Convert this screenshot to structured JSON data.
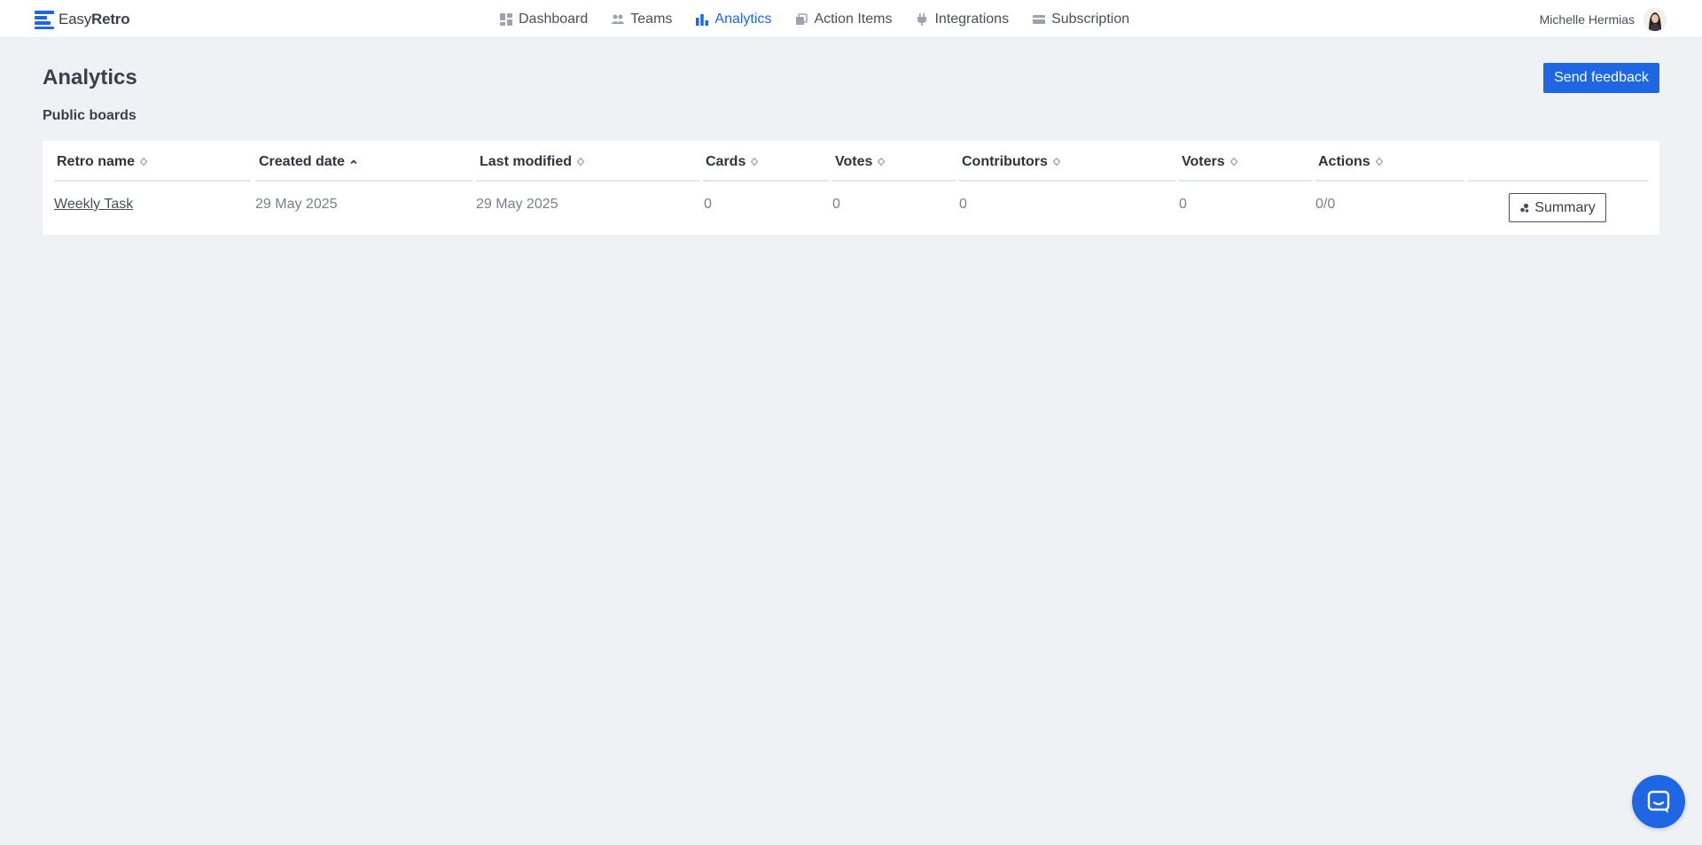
{
  "brand": {
    "name_light": "Easy",
    "name_bold": "Retro",
    "accent": "#1f66e5"
  },
  "nav": {
    "items": [
      {
        "label": "Dashboard",
        "icon": "dashboard-icon"
      },
      {
        "label": "Teams",
        "icon": "teams-icon"
      },
      {
        "label": "Analytics",
        "icon": "analytics-icon",
        "active": true
      },
      {
        "label": "Action Items",
        "icon": "action-items-icon"
      },
      {
        "label": "Integrations",
        "icon": "integrations-icon"
      },
      {
        "label": "Subscription",
        "icon": "subscription-icon"
      }
    ]
  },
  "user": {
    "name": "Michelle Hermias",
    "avatar_icon": "user-avatar"
  },
  "page": {
    "title": "Analytics",
    "feedback_label": "Send feedback",
    "section_title": "Public boards"
  },
  "table": {
    "columns": [
      {
        "label": "Retro name",
        "sort": "none"
      },
      {
        "label": "Created date",
        "sort": "asc"
      },
      {
        "label": "Last modified",
        "sort": "none"
      },
      {
        "label": "Cards",
        "sort": "none"
      },
      {
        "label": "Votes",
        "sort": "none"
      },
      {
        "label": "Contributors",
        "sort": "none"
      },
      {
        "label": "Voters",
        "sort": "none"
      },
      {
        "label": "Actions",
        "sort": "none"
      }
    ],
    "rows": [
      {
        "retro_name": "Weekly Task",
        "created": "29 May 2025",
        "modified": "29 May 2025",
        "cards": "0",
        "votes": "0",
        "contributors": "0",
        "voters": "0",
        "actions": "0/0",
        "summary_label": "Summary"
      }
    ]
  },
  "chat": {
    "icon": "chat-icon"
  }
}
